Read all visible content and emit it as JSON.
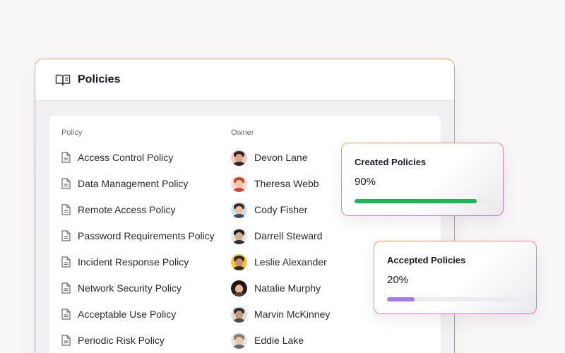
{
  "header": {
    "title": "Policies",
    "icon": "book-open-icon"
  },
  "table": {
    "columns": {
      "policy": "Policy",
      "owner": "Owner"
    },
    "rows": [
      {
        "policy": "Access Control Policy",
        "owner": "Devon Lane"
      },
      {
        "policy": "Data Management Policy",
        "owner": "Theresa Webb"
      },
      {
        "policy": "Remote Access Policy",
        "owner": "Cody Fisher"
      },
      {
        "policy": "Password Requirements Policy",
        "owner": "Darrell Steward"
      },
      {
        "policy": "Incident Response Policy",
        "owner": "Leslie Alexander"
      },
      {
        "policy": "Network Security Policy",
        "owner": "Natalie Murphy"
      },
      {
        "policy": "Acceptable Use Policy",
        "owner": "Marvin McKinney"
      },
      {
        "policy": "Periodic Risk Policy",
        "owner": "Eddie Lake"
      }
    ]
  },
  "stats": {
    "created": {
      "title": "Created Policies",
      "value": "90%",
      "progress": 0.9,
      "color": "#1fb35a"
    },
    "accepted": {
      "title": "Accepted Policies",
      "value": "20%",
      "progress": 0.2,
      "color": "#a47be8"
    }
  },
  "colors": {
    "accent_gradient_start": "#f0a060",
    "accent_gradient_end": "#dd66e0"
  }
}
